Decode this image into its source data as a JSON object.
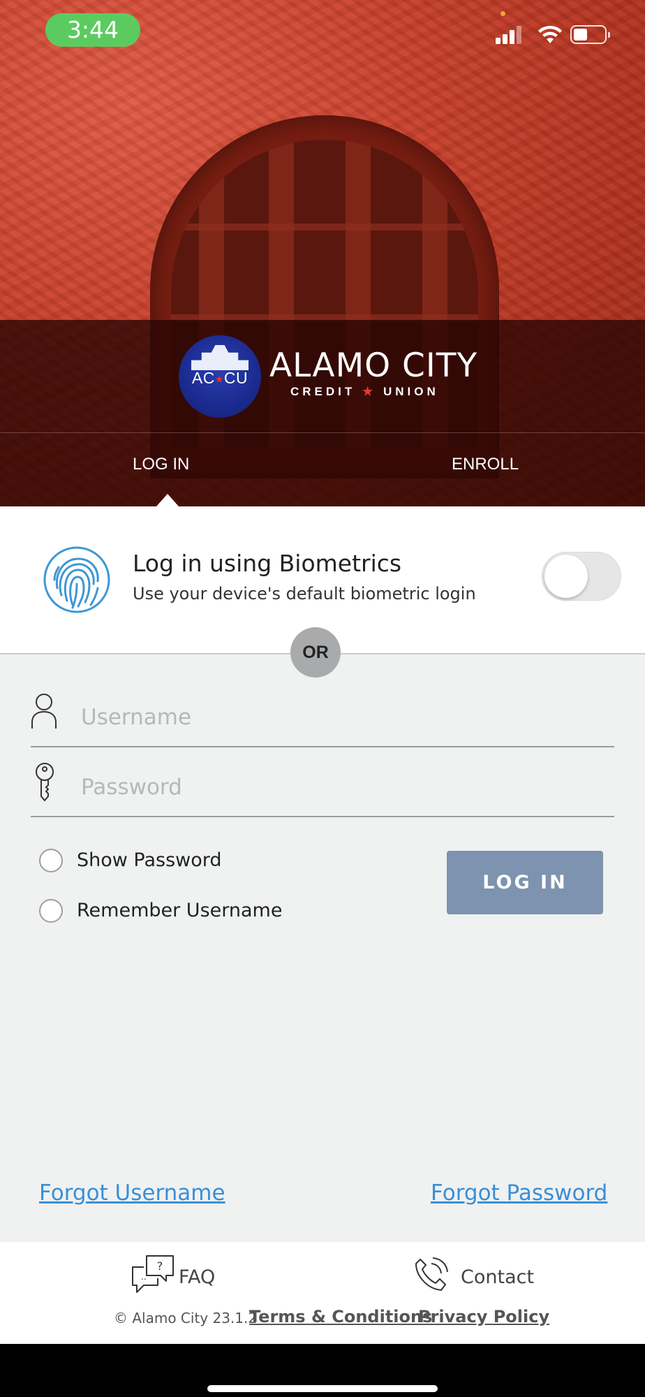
{
  "status_bar": {
    "time": "3:44"
  },
  "brand": {
    "initials_left": "AC",
    "initials_right": "CU",
    "name": "ALAMO CITY",
    "sub_left": "CREDIT",
    "sub_right": "UNION"
  },
  "tabs": {
    "login": "LOG IN",
    "enroll": "ENROLL"
  },
  "biometrics": {
    "title": "Log in using Biometrics",
    "subtitle": "Use your device's default biometric login",
    "enabled": false
  },
  "divider": {
    "label": "OR"
  },
  "form": {
    "username_placeholder": "Username",
    "password_placeholder": "Password",
    "show_password": "Show Password",
    "remember_username": "Remember Username",
    "login_button": "LOG IN"
  },
  "links": {
    "forgot_username": "Forgot Username",
    "forgot_password": "Forgot Password"
  },
  "footer": {
    "faq": "FAQ",
    "contact": "Contact",
    "copyright": "© Alamo City 23.1.2",
    "terms": "Terms & Conditions",
    "privacy": "Privacy Policy"
  },
  "colors": {
    "accent_link": "#3a8fd6",
    "login_button": "#7d93b0",
    "brand_red": "#c8402c"
  }
}
